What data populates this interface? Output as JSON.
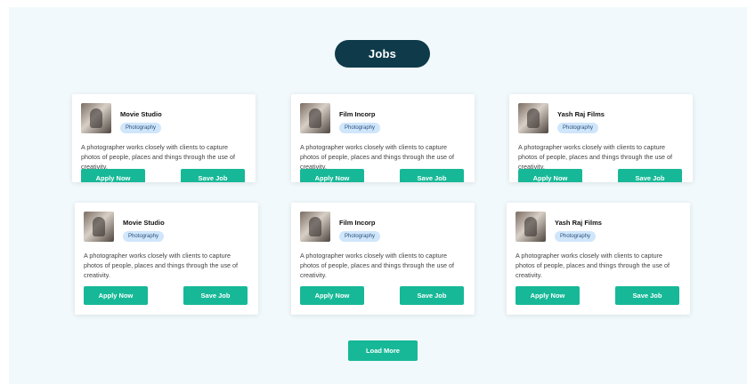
{
  "header": {
    "title": "Jobs"
  },
  "cards": [
    {
      "company": "Movie Studio",
      "category": "Photography",
      "description": "A photographer works closely with clients to capture photos of people, places and things through the use of creativity.",
      "apply_label": "Apply Now",
      "save_label": "Save Job"
    },
    {
      "company": "Film Incorp",
      "category": "Photography",
      "description": "A photographer works closely with clients to capture photos of people, places and things through the use of creativity.",
      "apply_label": "Apply Now",
      "save_label": "Save Job"
    },
    {
      "company": "Yash Raj Films",
      "category": "Photography",
      "description": "A photographer works closely with clients to capture photos of people, places and things through the use of creativity.",
      "apply_label": "Apply Now",
      "save_label": "Save Job"
    },
    {
      "company": "Movie Studio",
      "category": "Photography",
      "description": "A photographer works closely with clients to capture photos of people, places and things through the use of creativity.",
      "apply_label": "Apply Now",
      "save_label": "Save Job"
    },
    {
      "company": "Film Incorp",
      "category": "Photography",
      "description": "A photographer works closely with clients to capture photos of people, places and things through the use of creativity.",
      "apply_label": "Apply Now",
      "save_label": "Save Job"
    },
    {
      "company": "Yash Raj Films",
      "category": "Photography",
      "description": "A photographer works closely with clients to capture photos of people, places and things through the use of creativity.",
      "apply_label": "Apply Now",
      "save_label": "Save Job"
    }
  ],
  "footer": {
    "load_more_label": "Load More"
  },
  "colors": {
    "primary": "#17b897",
    "header_pill": "#0f3a4a",
    "badge_bg": "#cfe6fb",
    "section_bg": "#f1f9fc"
  }
}
